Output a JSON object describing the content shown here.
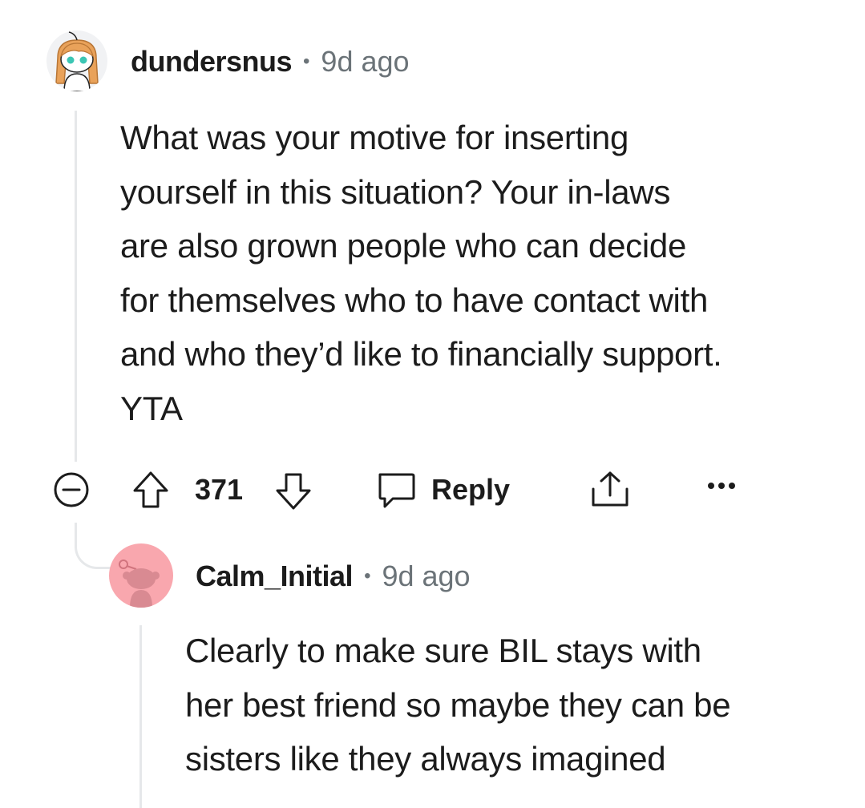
{
  "comment": {
    "author": "dundersnus",
    "separator": "•",
    "time": "9d ago",
    "body": "What was your motive for inserting\nyourself in this situation? Your in-laws\nare also grown people who can decide\nfor themselves who to have contact with\nand who they’d like to financially support.\nYTA",
    "score": "371",
    "reply_label": "Reply",
    "icons": [
      "collapse-icon",
      "upvote-icon",
      "downvote-icon",
      "reply-bubble-icon",
      "share-icon",
      "more-icon"
    ]
  },
  "reply": {
    "author": "Calm_Initial",
    "separator": "•",
    "time": "9d ago",
    "body": "Clearly to make sure BIL stays with\nher best friend so maybe they can be\nsisters like they always imagined"
  },
  "colors": {
    "text": "#1c1c1c",
    "meta": "#6b7378",
    "thread": "#e6e8ea",
    "avatar_pink": "#f9a7ae",
    "snoo_eyes": "#3cc6b4"
  }
}
